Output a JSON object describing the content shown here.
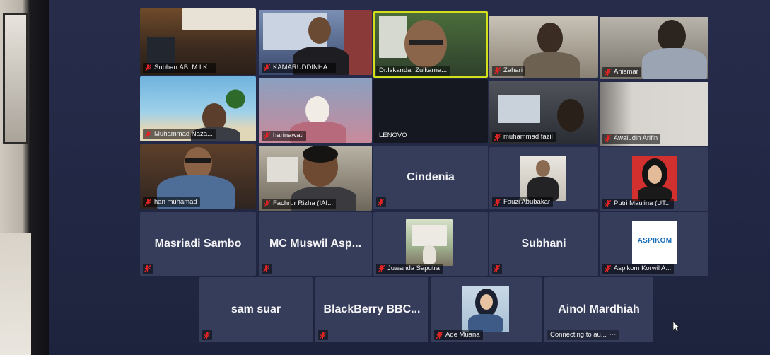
{
  "meeting": {
    "participants": [
      {
        "name": "Subhan.AB. M.I.K..."
      },
      {
        "name": "KAMARUDDINHA..."
      },
      {
        "name": "Dr.Iskandar Zulkarna..."
      },
      {
        "name": "Zahari"
      },
      {
        "name": "Anismar"
      },
      {
        "name": "Muhammad Naza..."
      },
      {
        "name": "harinawati"
      },
      {
        "name": "LENOVO"
      },
      {
        "name": "muhammad fazil"
      },
      {
        "name": "Awaludin Arifin"
      },
      {
        "name": "han muhamad"
      },
      {
        "name": "Fachrur Rizha (IAI..."
      },
      {
        "name": "Cindenia"
      },
      {
        "name": "Fauzi Abubakar"
      },
      {
        "name": "Putri Maulina (UT..."
      },
      {
        "name": "Masriadi Sambo"
      },
      {
        "name": "MC Muswil Asp..."
      },
      {
        "name": "Juwanda Saputra"
      },
      {
        "name": "Subhani"
      },
      {
        "name": "Aspikom Korwil A..."
      },
      {
        "name": "sam suar"
      },
      {
        "name": "BlackBerry BBC..."
      },
      {
        "name": "Ade Muana"
      },
      {
        "name": "Ainol Mardhiah"
      }
    ],
    "connecting_status": "Connecting to au...",
    "aspikom_logo_text": "ASPIKOM",
    "active_speaker_color": "#d4e11a",
    "mute_icon_color": "#e02424"
  }
}
